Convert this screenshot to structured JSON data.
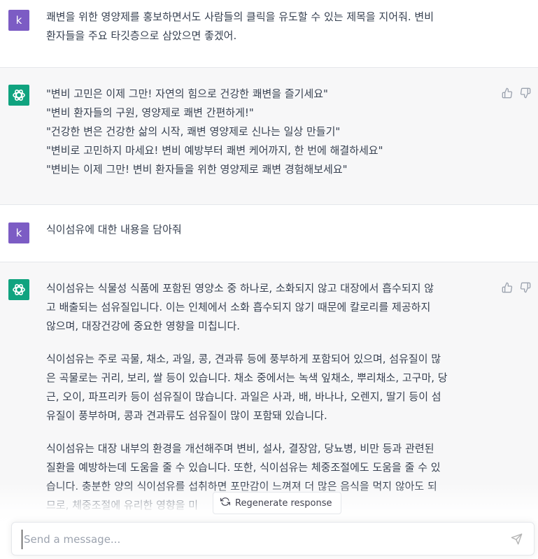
{
  "colors": {
    "user_avatar": "#7c5cc4",
    "assistant_avatar": "#10a37f",
    "assistant_bg": "#f7f7f8"
  },
  "conversation": [
    {
      "role": "user",
      "avatar_letter": "k",
      "lines": [
        "쾌변을 위한 영양제를 홍보하면서도 사람들의 클릭을 유도할 수 있는 제목을 지어줘. 변비",
        "환자들을 주요 타깃층으로 삼았으면 좋겠어."
      ]
    },
    {
      "role": "assistant",
      "avatar_icon": "openai-logo-icon",
      "lines": [
        "\"변비 고민은 이제 그만! 자연의 힘으로 건강한 쾌변을 즐기세요\"",
        "\"변비 환자들의 구원, 영양제로 쾌변 간편하게!\"",
        "\"건강한 변은 건강한 삶의 시작, 쾌변 영양제로 신나는 일상 만들기\"",
        "\"변비로 고민하지 마세요! 변비 예방부터 쾌변 케어까지, 한 번에 해결하세요\"",
        "\"변비는 이제 그만! 변비 환자들을 위한 영양제로 쾌변 경험해보세요\""
      ]
    },
    {
      "role": "user",
      "avatar_letter": "k",
      "lines": [
        "식이섬유에 대한 내용을 담아줘"
      ]
    },
    {
      "role": "assistant",
      "avatar_icon": "openai-logo-icon",
      "paragraphs": [
        [
          "식이섬유는 식물성 식품에 포함된 영양소 중 하나로, 소화되지 않고 대장에서 흡수되지 않",
          "고 배출되는 섬유질입니다. 이는 인체에서 소화 흡수되지 않기 때문에 칼로리를 제공하지",
          "않으며, 대장건강에 중요한 영향을 미칩니다."
        ],
        [
          "식이섬유는 주로 곡물, 채소, 과일, 콩, 견과류 등에 풍부하게 포함되어 있으며, 섬유질이 많",
          "은 곡물로는 귀리, 보리, 쌀 등이 있습니다. 채소 중에서는 녹색 잎채소, 뿌리채소, 고구마, 당",
          "근, 오이, 파프리카 등이 섬유질이 많습니다. 과일은 사과, 배, 바나나, 오렌지, 딸기 등이 섬",
          "유질이 풍부하며, 콩과 견과류도 섬유질이 많이 포함돼 있습니다."
        ],
        [
          "식이섬유는 대장 내부의 환경을 개선해주며 변비, 설사, 결장암, 당뇨병, 비만 등과 관련된",
          "질환을 예방하는데 도움을 줄 수 있습니다. 또한, 식이섬유는 체중조절에도 도움을 줄 수 있",
          "습니다. 충분한 양의 식이섬유를 섭취하면 포만감이 느껴져 더 많은 음식을 먹지 않아도 되",
          "므로, 체중조절에 유리한 영향을 미"
        ]
      ]
    }
  ],
  "regenerate_label": "Regenerate response",
  "composer": {
    "placeholder": "Send a message..."
  }
}
